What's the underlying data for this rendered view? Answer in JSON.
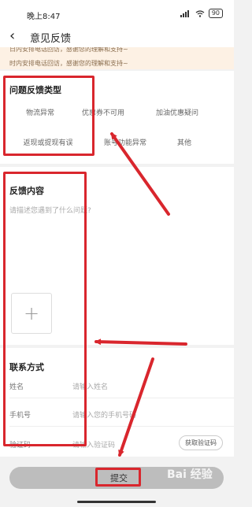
{
  "status_bar": {
    "time": "晚上8:47",
    "battery": "90"
  },
  "header": {
    "back_icon": "‹",
    "title": "意见反馈"
  },
  "notice": {
    "line1": "日内安排电话回访，感谢您的理解和支持~",
    "line2": "时内安排电话回访，感谢您的理解和支持~"
  },
  "problem_types": {
    "title": "问题反馈类型",
    "tags": [
      "物流异常",
      "优惠券不可用",
      "加油优惠疑问",
      "返现或提现有误",
      "账号功能异常",
      "其他"
    ]
  },
  "feedback": {
    "title": "反馈内容",
    "placeholder": "请描述您遇到了什么问题?",
    "add_icon": "+"
  },
  "contact": {
    "title": "联系方式",
    "name_label": "姓名",
    "name_placeholder": "请输入姓名",
    "phone_label": "手机号",
    "phone_placeholder": "请输入您的手机号码",
    "code_label": "验证码",
    "code_placeholder": "请输入验证码",
    "get_code_button": "获取验证码"
  },
  "submit": {
    "label": "提交"
  },
  "watermark": "Bai 经验",
  "colors": {
    "annotation_red": "#d9262d",
    "notice_bg": "#fdf1e4",
    "submit_bg": "#bdbdbd"
  }
}
